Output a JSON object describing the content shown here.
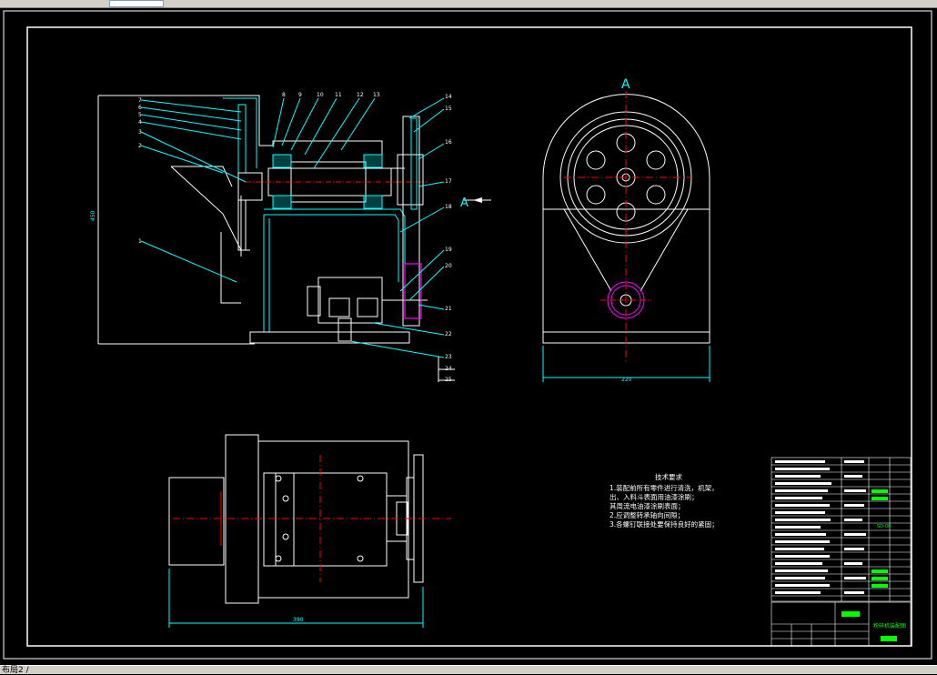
{
  "window": {
    "status_tab": "布局2 /",
    "scrollbar": true
  },
  "drawing": {
    "view_label_a": "A",
    "section_arrow_label": "A",
    "part_numbers_top": [
      "8",
      "9",
      "10",
      "11",
      "12",
      "13"
    ],
    "part_numbers_left": [
      "7",
      "6",
      "5",
      "4",
      "3",
      "2",
      "1"
    ],
    "part_numbers_right": [
      "14",
      "15",
      "16",
      "17",
      "18",
      "19",
      "20",
      "21",
      "22",
      "23",
      "24",
      "25"
    ],
    "dim_height": "450",
    "dim_width_right": "220",
    "dim_width_bottom": "390"
  },
  "tech_notes": {
    "title": "技术要求",
    "lines": [
      "1.装配前所有零件进行清洗，机架，",
      "出、入料斗表面用油漆涂刷；",
      "  其周流电油漆涂刷表面；",
      "2.应调整转承轴向间隙；",
      "3.各螺钉联接处要保持良好的紧固；"
    ]
  },
  "title_block": {
    "title": "粉碎机装配图",
    "code": "SD-00",
    "scale": "1:2"
  },
  "colors": {
    "background": "#000000",
    "line_white": "#ffffff",
    "line_cyan": "#00ffff",
    "center_red": "#ff0000",
    "highlight_magenta": "#ff00ff",
    "title_green": "#00ff00"
  }
}
